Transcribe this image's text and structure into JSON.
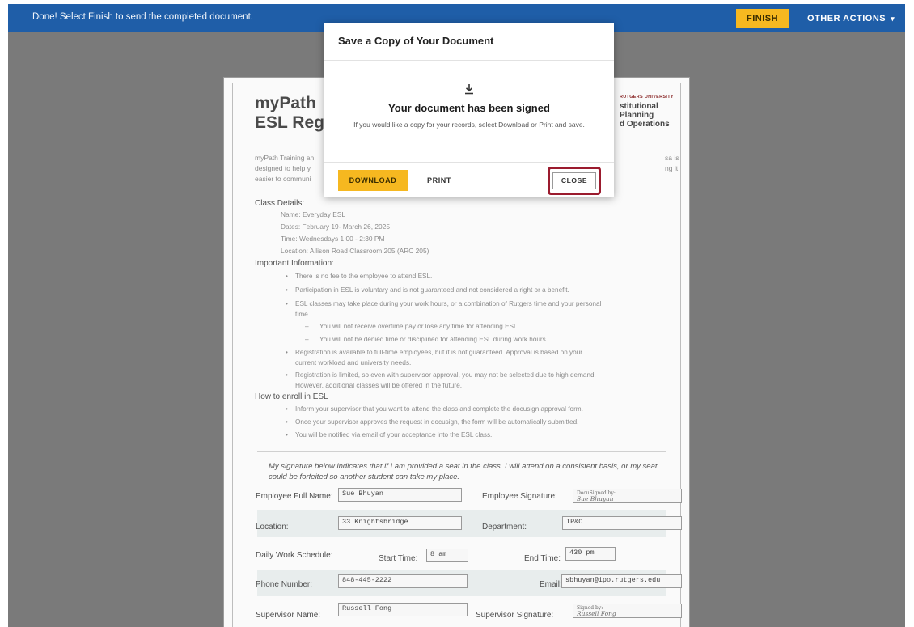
{
  "topbar": {
    "message": "Done! Select Finish to send the completed document.",
    "finish_label": "FINISH",
    "other_actions_label": "OTHER ACTIONS",
    "other_actions_caret": "▾",
    "color": "#1f5ea8",
    "finish_color": "#f6b820"
  },
  "document": {
    "title_line1": "myPath",
    "title_line2": "ESL Regist",
    "logo": {
      "university": "RUTGERS UNIVERSITY",
      "line1": "stitutional Planning",
      "line2": "d Operations"
    },
    "intro": [
      "myPath Training an",
      "designed to help y",
      "easier to communi"
    ],
    "intro_right": [
      "sa is",
      "ng it"
    ],
    "class_details_heading": "Class Details:",
    "class_details": [
      "Name: Everyday ESL",
      "Dates: February 19- March 26, 2025",
      "Time: Wednesdays 1:00 - 2:30 PM",
      "Location: Allison Road Classroom 205 (ARC 205)"
    ],
    "important_heading": "Important Information:",
    "important": [
      "There is no fee to the employee to attend ESL.",
      "Participation in ESL is voluntary and is not guaranteed and not considered a right or a benefit.",
      "ESL classes may take place during your work hours, or a combination of Rutgers time and your personal",
      "time."
    ],
    "important_sub": [
      "You will not receive overtime pay or lose any time for attending ESL.",
      "You will not be denied time or disciplined for attending ESL during work hours."
    ],
    "important_more": [
      "Registration is available to full-time employees, but it is not guaranteed. Approval is based on your",
      "current workload and university needs.",
      "Registration is limited, so even with supervisor approval, you may not be selected due to high demand.",
      "However, additional classes will be offered in the future."
    ],
    "enroll_heading": "How to enroll in ESL",
    "enroll": [
      "Inform your supervisor that you want to attend the class and complete the docusign approval form.",
      "Once your supervisor approves the request in docusign, the form will be automatically submitted.",
      "You will be notified via email of your acceptance into the ESL class."
    ],
    "signature_note": "My signature below indicates that if I am provided a seat in the class, I will attend on a consistent basis, or my seat could be forfeited so another student can take my place.",
    "form": {
      "employee_name_label": "Employee Full Name:",
      "employee_name": "Sue Bhuyan",
      "employee_sig_label": "Employee Signature:",
      "employee_sig_caption": "DocuSigned by:",
      "employee_sig_mark": "Sue Bhuyan",
      "location_label": "Location:",
      "location": "33 Knightsbridge",
      "department_label": "Department:",
      "department": "IP&O",
      "schedule_label": "Daily Work Schedule:",
      "start_label": "Start Time:",
      "start": "8 am",
      "end_label": "End Time:",
      "end": "430 pm",
      "phone_label": "Phone Number:",
      "phone": "848-445-2222",
      "email_label": "Email:",
      "email": "sbhuyan@ipo.rutgers.edu",
      "supervisor_label": "Supervisor Name:",
      "supervisor": "Russell Fong",
      "supervisor_sig_label": "Supervisor Signature:",
      "supervisor_sig_caption": "Signed by:",
      "supervisor_sig_mark": "Russell Fong"
    }
  },
  "modal": {
    "title": "Save a Copy of Your Document",
    "icon": "download-icon",
    "heading": "Your document has been signed",
    "info": "If you would like a copy for your records, select Download or Print and save.",
    "download_label": "DOWNLOAD",
    "print_label": "PRINT",
    "close_label": "CLOSE",
    "highlight_color": "#9b1b2e"
  }
}
